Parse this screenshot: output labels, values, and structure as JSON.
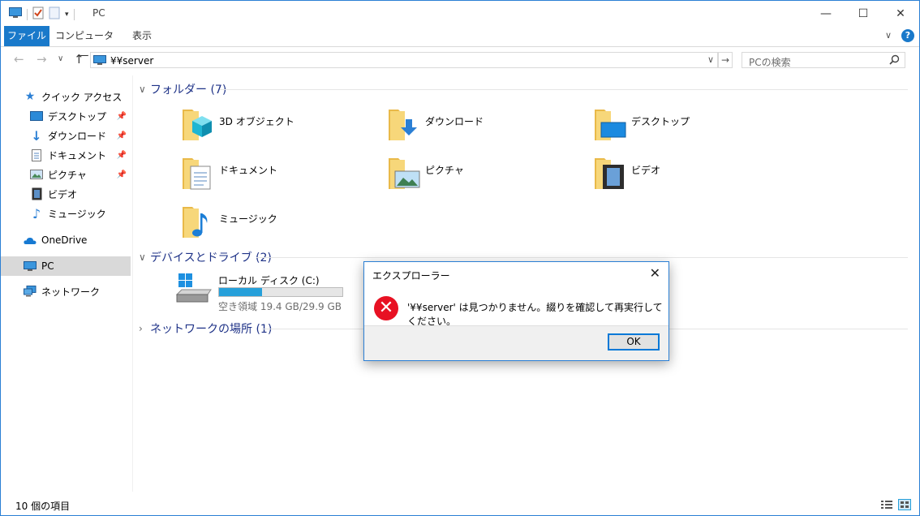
{
  "window": {
    "title": "PC"
  },
  "ribbon": {
    "tabs": [
      "ファイル",
      "コンピューター",
      "表示"
    ],
    "help": "?"
  },
  "address": {
    "path": "¥¥server",
    "search_placeholder": "PCの検索"
  },
  "nav": {
    "quick_access": "クイック アクセス",
    "items": [
      "デスクトップ",
      "ダウンロード",
      "ドキュメント",
      "ピクチャ",
      "ビデオ",
      "ミュージック"
    ],
    "onedrive": "OneDrive",
    "pc": "PC",
    "network": "ネットワーク"
  },
  "groups": {
    "folders": "フォルダー (7)",
    "devices": "デバイスとドライブ (2)",
    "network_locations": "ネットワークの場所 (1)"
  },
  "folders": [
    "3D オブジェクト",
    "ダウンロード",
    "デスクトップ",
    "ドキュメント",
    "ピクチャ",
    "ビデオ",
    "ミュージック"
  ],
  "drive": {
    "label": "ローカル ディスク (C:)",
    "free": "空き領域 19.4 GB/29.9 GB",
    "used_fraction": 0.35
  },
  "status": {
    "items": "10 個の項目"
  },
  "dialog": {
    "title": "エクスプローラー",
    "message": "'¥¥server' は見つかりません。綴りを確認して再実行してください。",
    "ok": "OK"
  }
}
